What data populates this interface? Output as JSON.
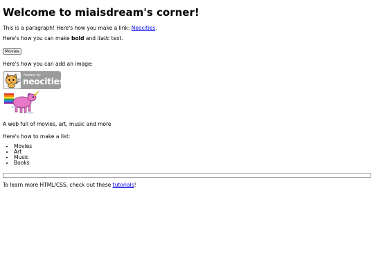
{
  "heading": "Welcome to miaisdream's corner!",
  "para_link": {
    "prefix": "This is a paragraph! Here's how you make a link: ",
    "link_text": "Neocities",
    "suffix": "."
  },
  "para_format": {
    "prefix": "Here's how you can make ",
    "bold": "bold",
    "middle": " and ",
    "italic": "italic",
    "suffix": " text."
  },
  "movies_button": "Movies",
  "image_intro": "Here's how you can add an image:",
  "badge": {
    "hosted_by": "hosted by",
    "brand": "neocities"
  },
  "tagline": "A web full of movies, art, music and more",
  "list_intro": "Here's how to make a list:",
  "list_items": [
    "Movies",
    "Art",
    "Music",
    "Books"
  ],
  "footer": {
    "prefix": "To learn more HTML/CSS, check out these ",
    "link_text": "tutorials",
    "suffix": "!"
  }
}
